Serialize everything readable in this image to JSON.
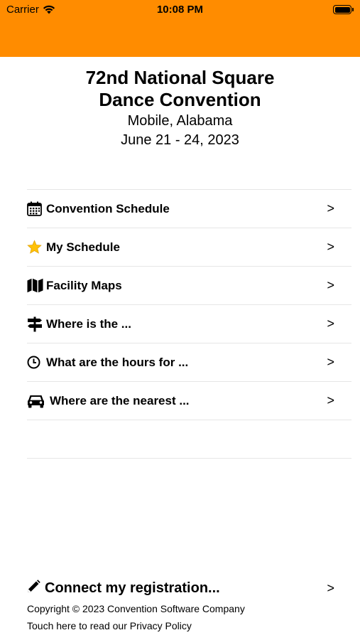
{
  "status_bar": {
    "carrier": "Carrier",
    "time": "10:08 PM"
  },
  "header": {
    "accent_color": "#FF8C00"
  },
  "title": {
    "line1": "72nd National Square",
    "line2": "Dance Convention",
    "location": "Mobile, Alabama",
    "dates": "June 21 - 24, 2023"
  },
  "menu": {
    "items": [
      {
        "label": "Convention Schedule",
        "icon": "calendar-icon",
        "chevron": ">"
      },
      {
        "label": "My Schedule",
        "icon": "star-icon",
        "chevron": ">"
      },
      {
        "label": "Facility Maps",
        "icon": "map-icon",
        "chevron": ">"
      },
      {
        "label": "Where is the ...",
        "icon": "signpost-icon",
        "chevron": ">"
      },
      {
        "label": "What are the hours for ...",
        "icon": "clock-icon",
        "chevron": ">"
      },
      {
        "label": "Where are the nearest ...",
        "icon": "car-icon",
        "chevron": ">"
      }
    ]
  },
  "footer": {
    "connect_label": "Connect my registration...",
    "connect_icon": "pencil-icon",
    "connect_chevron": ">",
    "copyright": "Copyright © 2023 Convention Software Company",
    "privacy": "Touch here to read our Privacy Policy"
  }
}
